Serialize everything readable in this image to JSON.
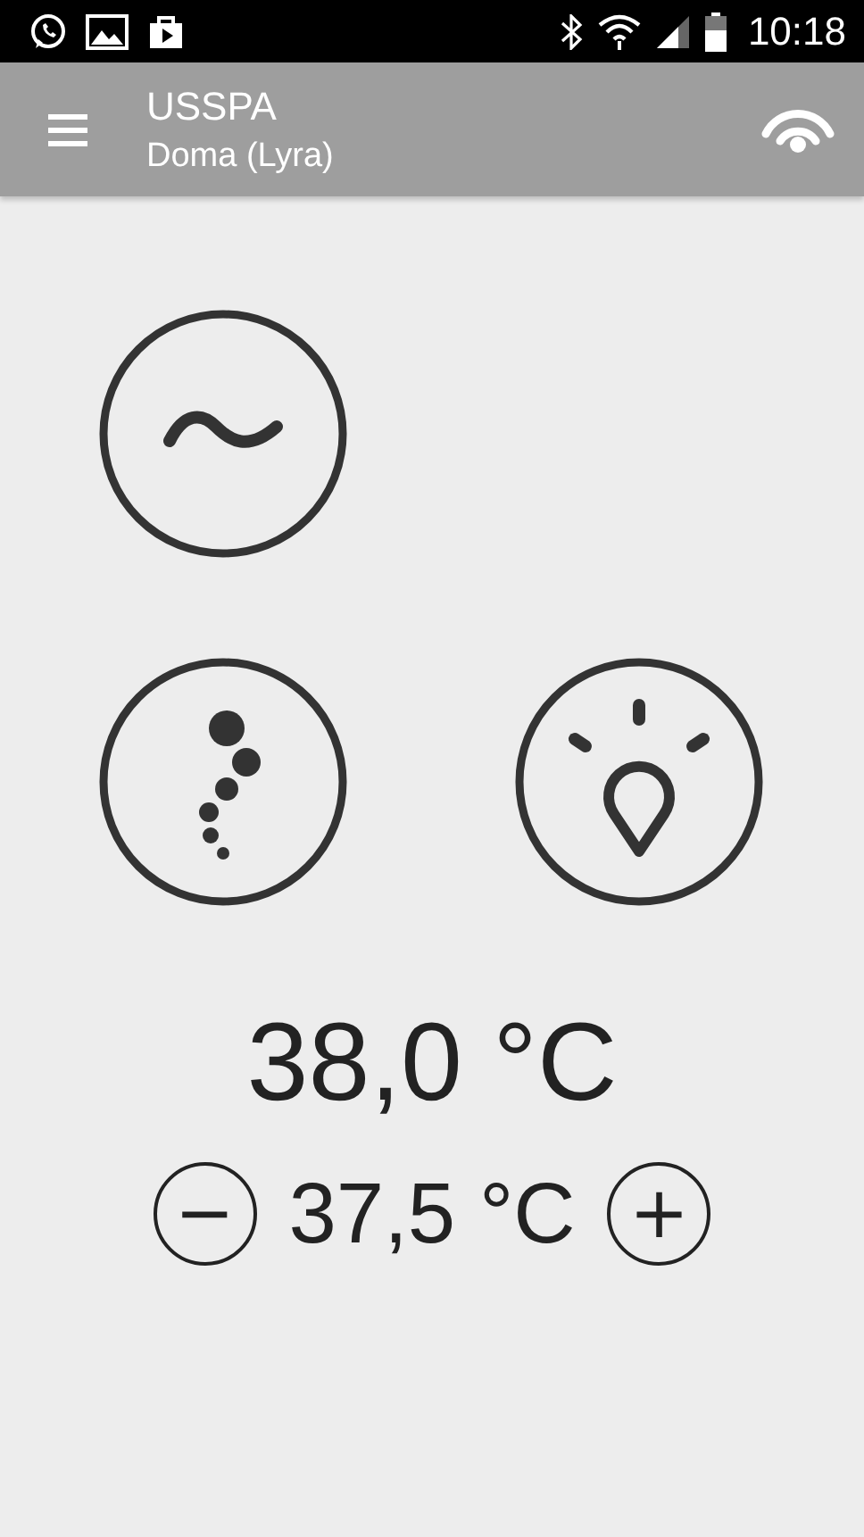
{
  "status_bar": {
    "time": "10:18"
  },
  "app_bar": {
    "title": "USSPA",
    "subtitle": "Doma (Lyra)"
  },
  "controls": [
    {
      "kind": "wave"
    },
    {
      "kind": "bubbles"
    },
    {
      "kind": "light"
    }
  ],
  "current_temperature": "38,0 °C",
  "setpoint": {
    "minus": "−",
    "value": "37,5 °C",
    "plus": "+"
  }
}
